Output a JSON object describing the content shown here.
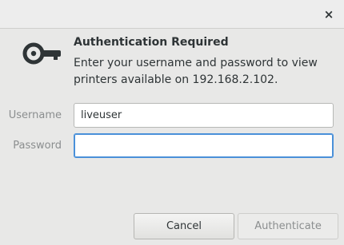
{
  "window": {
    "close_glyph": "×"
  },
  "dialog": {
    "icon": "key-icon",
    "heading": "Authentication Required",
    "message": "Enter your username and password to view printers available on 192.168.2.102.",
    "fields": [
      {
        "label": "Username",
        "value": "liveuser"
      },
      {
        "label": "Password",
        "value": ""
      }
    ],
    "buttons": {
      "cancel": "Cancel",
      "authenticate": "Authenticate"
    }
  },
  "colors": {
    "focus_border": "#4a90d9",
    "text": "#2e3436",
    "dim_text": "#8b8e8f"
  }
}
